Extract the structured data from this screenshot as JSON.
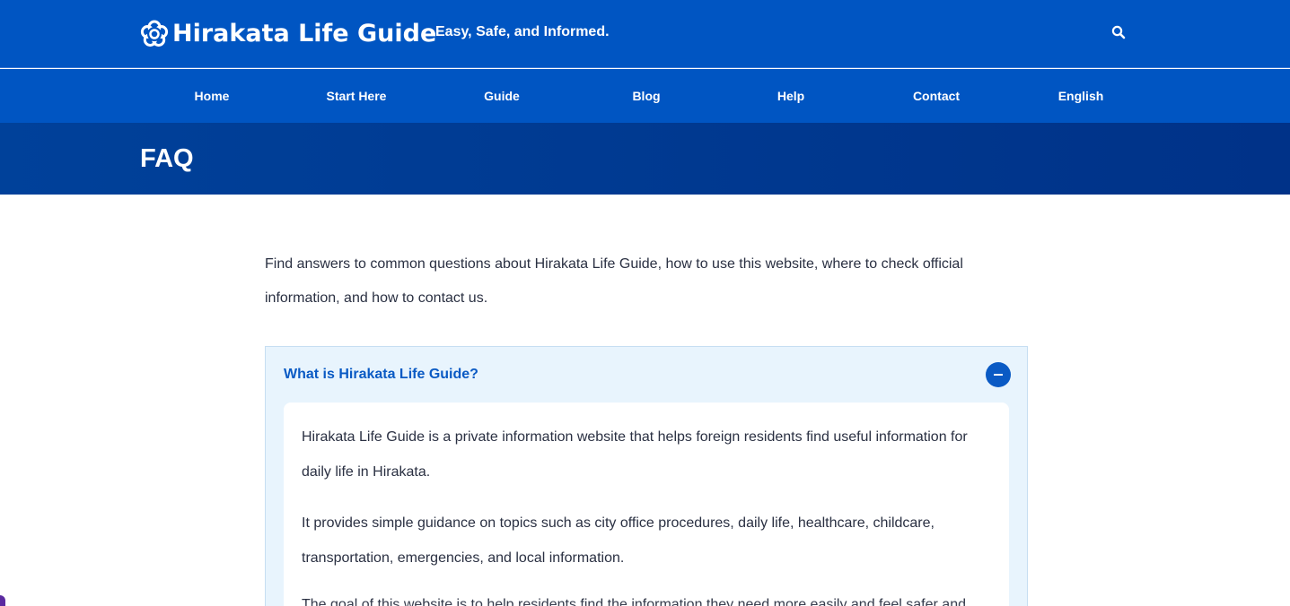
{
  "header": {
    "logo_text": "Hirakata Life Guide",
    "logo_icon": "flower-icon",
    "tagline": "Easy, Safe, and Informed.",
    "search_icon": "search-icon"
  },
  "nav": {
    "items": [
      {
        "label": "Home"
      },
      {
        "label": "Start Here"
      },
      {
        "label": "Guide"
      },
      {
        "label": "Blog"
      },
      {
        "label": "Help"
      },
      {
        "label": "Contact"
      },
      {
        "label": "English"
      }
    ]
  },
  "page": {
    "title": "FAQ",
    "intro": "Find answers to common questions about Hirakata Life Guide, how to use this website, where to check official information, and how to contact us."
  },
  "faq": {
    "question": "What is Hirakata Life Guide?",
    "toggle_icon": "minus-icon",
    "answer": [
      "Hirakata Life Guide is a private information website that helps foreign residents find useful information for daily life in Hirakata.",
      "It provides simple guidance on topics such as city office procedures, daily life, healthcare, childcare, transportation, emergencies, and local information.",
      "The goal of this website is to help residents find the information they need more easily and feel safer and"
    ]
  },
  "colors": {
    "header_blue": "#0055c2",
    "title_bar_blue": "#003a92",
    "faq_bg": "#e8f4fd",
    "accent": "#0a5ac4"
  }
}
